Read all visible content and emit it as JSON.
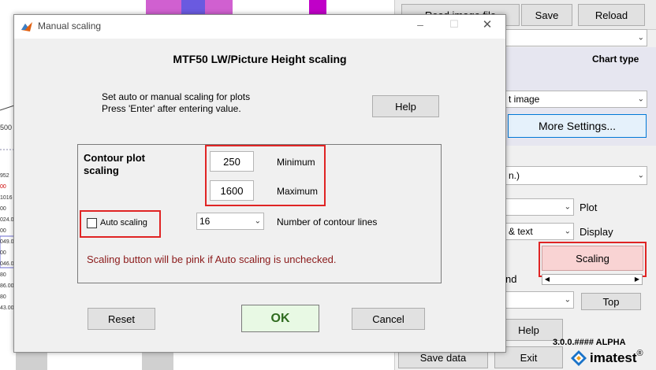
{
  "background_app": {
    "buttons": {
      "read_image_file": "Read image file",
      "save": "Save",
      "reload": "Reload",
      "more_settings": "More Settings...",
      "scaling": "Scaling",
      "top": "Top",
      "help": "Help",
      "save_data": "Save data",
      "exit": "Exit"
    },
    "chart_type_label": "Chart type",
    "combo_image": "t image",
    "combo_units": "n.)",
    "combo_text": "& text",
    "plot_label": "Plot",
    "display_label": "Display",
    "and_label": "nd",
    "version": "3.0.0.#### ALPHA",
    "logo_text": "imatest",
    "logo_mark": "®",
    "axis_labels": [
      "500",
      "952",
      "00",
      "1016",
      "00",
      "024.0",
      "00",
      "049.0",
      "00",
      "046.0",
      "80",
      "86.00",
      "80",
      "43.00"
    ]
  },
  "dialog": {
    "title": "Manual scaling",
    "heading": "MTF50 LW/Picture Height scaling",
    "instructions_line1": "Set auto or manual scaling for plots",
    "instructions_line2": "Press 'Enter' after entering value.",
    "help_button": "Help",
    "contour_label_line1": "Contour plot",
    "contour_label_line2": "scaling",
    "minimum_value": "250",
    "minimum_label": "Minimum",
    "maximum_value": "1600",
    "maximum_label": "Maximum",
    "auto_scaling_label": "Auto scaling",
    "auto_scaling_checked": false,
    "contour_lines_value": "16",
    "contour_lines_label": "Number of contour lines",
    "note": "Scaling button will be pink if Auto scaling is unchecked.",
    "reset_button": "Reset",
    "ok_button": "OK",
    "cancel_button": "Cancel"
  },
  "colors": {
    "annotation_red": "#e02424",
    "scaling_pink": "#f9d3d3",
    "ok_green": "#e8f9e4",
    "ok_text": "#2f6b1f",
    "note_text": "#8b1a1a",
    "more_settings_bg": "#e5f1fb"
  }
}
